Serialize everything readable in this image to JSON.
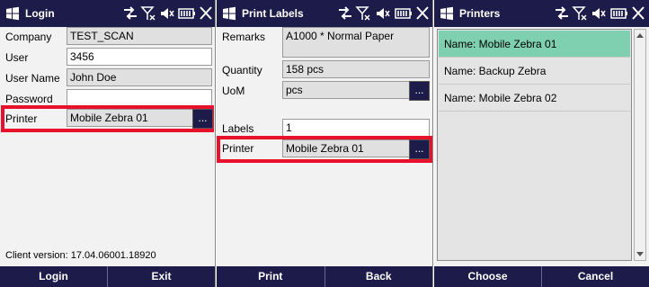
{
  "login": {
    "title": "Login",
    "fields": {
      "company": {
        "label": "Company",
        "value": "TEST_SCAN"
      },
      "user": {
        "label": "User",
        "value": "3456"
      },
      "user_name": {
        "label": "User Name",
        "value": "John Doe"
      },
      "password": {
        "label": "Password",
        "value": ""
      },
      "printer": {
        "label": "Printer",
        "value": "Mobile Zebra 01",
        "button": "..."
      }
    },
    "client_version": "Client version: 17.04.06001.18920",
    "buttons": {
      "left": "Login",
      "right": "Exit"
    }
  },
  "print_labels": {
    "title": "Print Labels",
    "fields": {
      "remarks": {
        "label": "Remarks",
        "value": "A1000 * Normal Paper"
      },
      "quantity": {
        "label": "Quantity",
        "value": "158 pcs"
      },
      "uom": {
        "label": "UoM",
        "value": "pcs",
        "button": "..."
      },
      "labels": {
        "label": "Labels",
        "value": "1"
      },
      "printer": {
        "label": "Printer",
        "value": "Mobile Zebra 01",
        "button": "..."
      }
    },
    "buttons": {
      "left": "Print",
      "right": "Back"
    }
  },
  "printers": {
    "title": "Printers",
    "items": [
      {
        "label": "Name: Mobile Zebra 01",
        "selected": true
      },
      {
        "label": "Name: Backup Zebra",
        "selected": false
      },
      {
        "label": "Name: Mobile Zebra 02",
        "selected": false
      }
    ],
    "buttons": {
      "left": "Choose",
      "right": "Cancel"
    }
  },
  "colors": {
    "titlebar": "#1c1b4a",
    "highlight": "#e8102a",
    "selected_row": "#7ed0b0"
  },
  "icons": [
    "windows-logo-icon",
    "connectivity-icon",
    "no-signal-icon",
    "volume-muted-icon",
    "battery-icon",
    "close-icon"
  ]
}
